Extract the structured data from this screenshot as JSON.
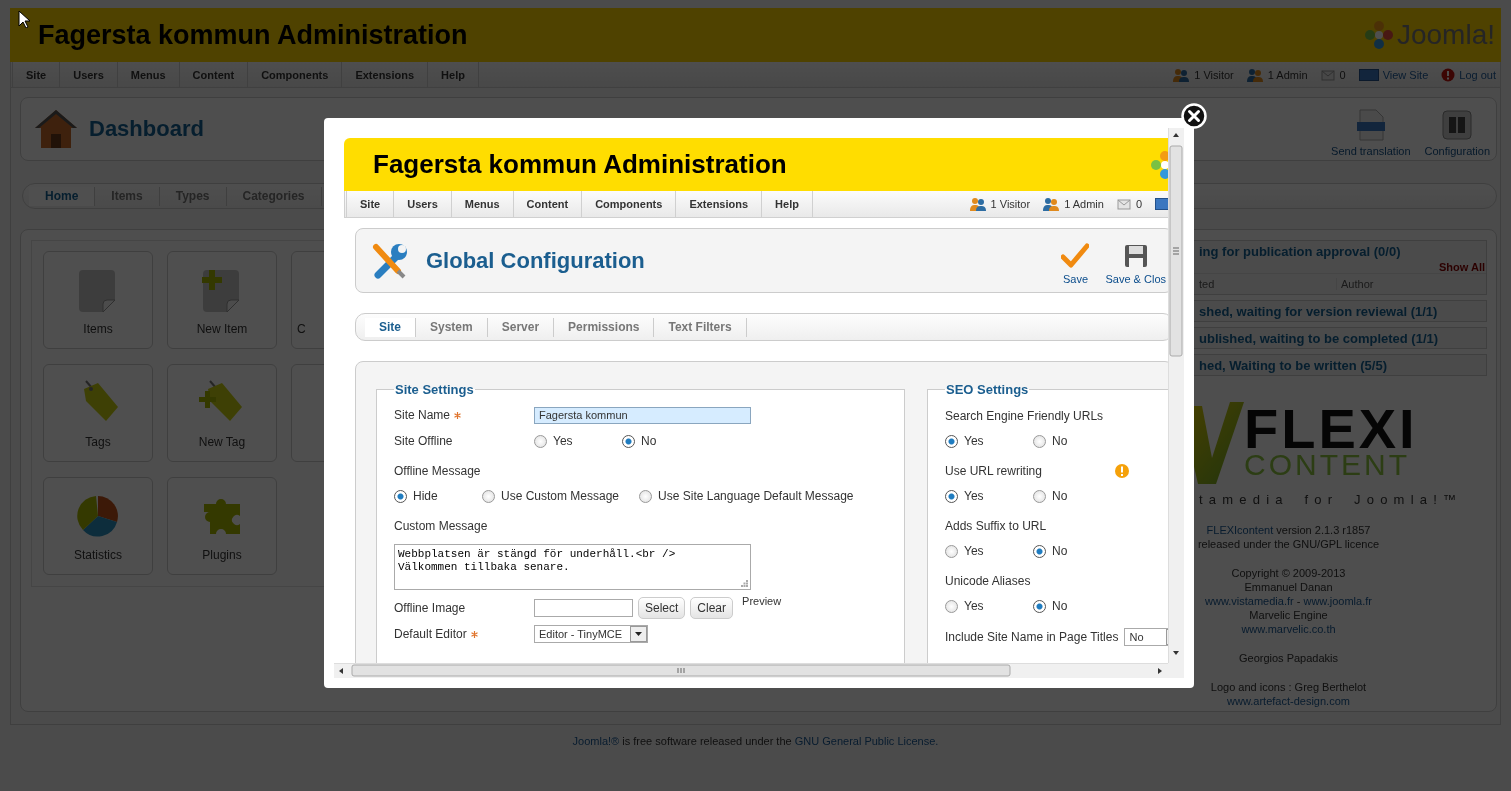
{
  "header": {
    "title": "Fagersta kommun Administration",
    "logo_text": "Joomla!"
  },
  "menu": [
    "Site",
    "Users",
    "Menus",
    "Content",
    "Components",
    "Extensions",
    "Help"
  ],
  "status": [
    {
      "kind": "visitor",
      "label": "1 Visitor"
    },
    {
      "kind": "admin",
      "label": "1 Admin"
    },
    {
      "kind": "messages",
      "label": "0"
    },
    {
      "kind": "view",
      "label": "View Site"
    },
    {
      "kind": "logout",
      "label": "Log out"
    }
  ],
  "dashboard": {
    "title": "Dashboard",
    "toolbar": [
      {
        "kind": "html",
        "label": "Send translation"
      },
      {
        "kind": "config",
        "label": "Configuration"
      }
    ]
  },
  "subnav": [
    {
      "label": "Home",
      "selected": true
    },
    {
      "label": "Items",
      "selected": false
    },
    {
      "label": "Types",
      "selected": false
    },
    {
      "label": "Categories",
      "selected": false
    }
  ],
  "shortcuts": [
    {
      "kind": "page",
      "label": "Items"
    },
    {
      "kind": "page-add",
      "label": "New Item"
    },
    {
      "kind": "cut",
      "label": "C"
    },
    {
      "kind": "tag",
      "label": "Tags"
    },
    {
      "kind": "tag-add",
      "label": "New Tag"
    },
    {
      "kind": "cut"
    },
    {
      "kind": "pie",
      "label": "Statistics"
    },
    {
      "kind": "puzzle",
      "label": "Plugins"
    }
  ],
  "pending": [
    {
      "title": "ing for publication approval (0/0)",
      "show_all": "Show All",
      "columns": [
        "ted",
        "Author"
      ]
    },
    {
      "title": "shed, waiting for version reviewal (1/1)"
    },
    {
      "title": "ublished, waiting to be completed (1/1)"
    },
    {
      "title": "hed, Waiting to be written (5/5)"
    }
  ],
  "flexi": {
    "word": "FLEXI",
    "sub": "CONTENT",
    "tagline": "tamedia for Joomla!™"
  },
  "credits": [
    {
      "kind": "plain",
      "parts": [
        {
          "kind": "link",
          "text": "FLEXIcontent"
        },
        {
          "kind": "text",
          "text": "version 2.1.3 r1857"
        }
      ]
    },
    {
      "kind": "plain",
      "parts": [
        {
          "kind": "text",
          "text": "released under the GNU/GPL licence"
        }
      ]
    },
    {
      "kind": "spaced",
      "parts": [
        {
          "kind": "text",
          "text": "Copyright © 2009-2013"
        }
      ]
    },
    {
      "kind": "plain",
      "parts": [
        {
          "kind": "text",
          "text": "Emmanuel Danan"
        }
      ]
    },
    {
      "kind": "plain",
      "parts": [
        {
          "kind": "link",
          "text": "www.vistamedia.fr"
        },
        {
          "kind": "text",
          "text": "-"
        },
        {
          "kind": "link",
          "text": "www.joomla.fr"
        }
      ]
    },
    {
      "kind": "plain",
      "parts": [
        {
          "kind": "text",
          "text": "Marvelic Engine"
        }
      ]
    },
    {
      "kind": "plain",
      "parts": [
        {
          "kind": "link",
          "text": "www.marvelic.co.th"
        }
      ]
    },
    {
      "kind": "spaced",
      "parts": [
        {
          "kind": "text",
          "text": "Georgios Papadakis"
        }
      ]
    },
    {
      "kind": "spaced",
      "parts": [
        {
          "kind": "text",
          "text": "Logo and icons : Greg Berthelot"
        }
      ]
    },
    {
      "kind": "plain",
      "parts": [
        {
          "kind": "link",
          "text": "www.artefact-design.com"
        }
      ]
    }
  ],
  "footer": [
    {
      "kind": "link",
      "text": "Joomla!®"
    },
    {
      "kind": "text",
      "text": "is free software released under the"
    },
    {
      "kind": "link",
      "text": "GNU General Public License."
    }
  ],
  "modal": {
    "header": {
      "title": "Fagersta kommun Administration"
    },
    "menu": [
      "Site",
      "Users",
      "Menus",
      "Content",
      "Components",
      "Extensions",
      "Help"
    ],
    "status": [
      {
        "kind": "visitor",
        "label": "1 Visitor"
      },
      {
        "kind": "admin",
        "label": "1 Admin"
      },
      {
        "kind": "messages",
        "label": "0"
      },
      {
        "kind": "view"
      }
    ],
    "title": "Global Configuration",
    "toolbar": [
      {
        "kind": "save",
        "label": "Save"
      },
      {
        "kind": "save-close",
        "label": "Save & Clos"
      }
    ],
    "tabs": [
      {
        "label": "Site",
        "selected": true
      },
      {
        "label": "System",
        "selected": false
      },
      {
        "label": "Server",
        "selected": false
      },
      {
        "label": "Permissions",
        "selected": false
      },
      {
        "label": "Text Filters",
        "selected": false
      }
    ],
    "fieldsets": [
      {
        "legend": "Site Settings",
        "kind": "aligned",
        "fields": [
          {
            "kind": "text",
            "label": "Site Name",
            "required": true,
            "value": "Fagersta kommun",
            "focused": true
          },
          {
            "kind": "radio-inline",
            "label": "Site Offline",
            "options": [
              {
                "label": "Yes",
                "selected": false
              },
              {
                "label": "No",
                "selected": true
              }
            ]
          },
          {
            "kind": "radio",
            "label": "Offline Message",
            "options": [
              {
                "label": "Hide",
                "selected": true
              },
              {
                "label": "Use Custom Message",
                "selected": false
              },
              {
                "label": "Use Site Language Default Message",
                "selected": false
              }
            ]
          },
          {
            "kind": "textarea",
            "label": "Custom Message",
            "value": "Webbplatsen är stängd för underhåll.<br />\nVälkommen tillbaka senare."
          },
          {
            "kind": "image",
            "label": "Offline Image",
            "buttons": [
              "Select",
              "Clear"
            ],
            "preview": "Preview"
          },
          {
            "kind": "select",
            "label": "Default Editor",
            "required": true,
            "value": "Editor - TinyMCE"
          }
        ]
      },
      {
        "legend": "SEO Settings",
        "kind": "compact",
        "fields": [
          {
            "kind": "radio",
            "label": "Search Engine Friendly URLs",
            "options": [
              {
                "label": "Yes",
                "selected": true
              },
              {
                "label": "No",
                "selected": false
              }
            ]
          },
          {
            "kind": "radio",
            "label": "Use URL rewriting",
            "warning": true,
            "options": [
              {
                "label": "Yes",
                "selected": true
              },
              {
                "label": "No",
                "selected": false
              }
            ]
          },
          {
            "kind": "radio",
            "label": "Adds Suffix to URL",
            "options": [
              {
                "label": "Yes",
                "selected": false
              },
              {
                "label": "No",
                "selected": true
              }
            ]
          },
          {
            "kind": "radio",
            "label": "Unicode Aliases",
            "options": [
              {
                "label": "Yes",
                "selected": false
              },
              {
                "label": "No",
                "selected": true
              }
            ]
          },
          {
            "kind": "select",
            "label": "Include Site Name in Page Titles",
            "value": "No"
          }
        ]
      }
    ]
  }
}
